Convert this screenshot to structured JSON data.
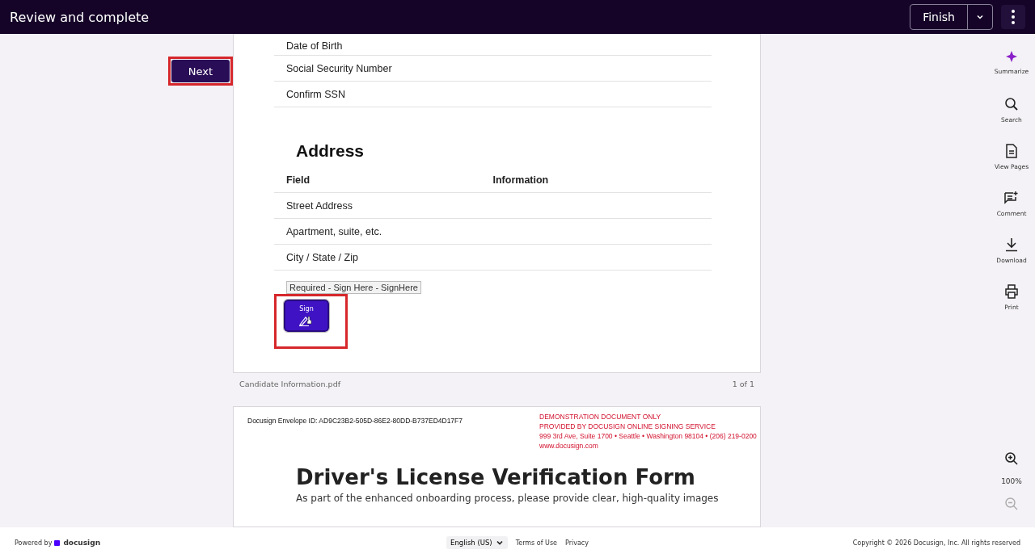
{
  "header": {
    "title": "Review and complete",
    "finish_button": "Finish"
  },
  "next_button": "Next",
  "document": {
    "rows": [
      "Date of Birth",
      "Social Security Number",
      "Confirm SSN"
    ],
    "address": {
      "heading": "Address",
      "columns": [
        "Field",
        "Information"
      ],
      "rows": [
        "Street Address",
        "Apartment, suite, etc.",
        "City / State / Zip"
      ]
    },
    "sign_tooltip": "Required - Sign Here - SignHere",
    "sign_label": "Sign"
  },
  "page_footer": {
    "filename": "Candidate Information.pdf",
    "page_count": "1 of 1"
  },
  "second_page": {
    "envelope_id": "Docusign Envelope ID: AD9C23B2-505D-86E2-80DD-B737ED4D17F7",
    "demo_lines": [
      "DEMONSTRATION DOCUMENT ONLY",
      "PROVIDED BY DOCUSIGN ONLINE SIGNING SERVICE",
      "999 3rd Ave, Suite 1700  • Seattle • Washington 98104 • (206) 219-0200",
      "www.docusign.com"
    ],
    "title": "Driver's License Verification Form",
    "intro": "As part of the enhanced onboarding process, please provide clear, high-quality images"
  },
  "tools": [
    {
      "kind": "summarize",
      "label": "Summarize"
    },
    {
      "kind": "search",
      "label": "Search"
    },
    {
      "kind": "pages",
      "label": "View Pages"
    },
    {
      "kind": "comment",
      "label": "Comment"
    },
    {
      "kind": "download",
      "label": "Download"
    },
    {
      "kind": "print",
      "label": "Print"
    }
  ],
  "zoom": {
    "level_text": "100%"
  },
  "footer": {
    "powered_by": "Powered by",
    "brand": "docusign",
    "language": "English (US)",
    "links": [
      "Terms of Use",
      "Privacy"
    ],
    "copyright": "Copyright © 2026 Docusign, Inc. All rights reserved"
  }
}
